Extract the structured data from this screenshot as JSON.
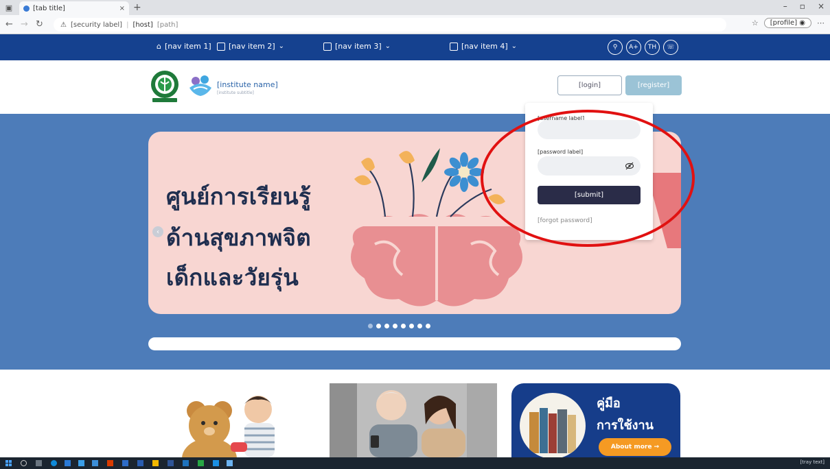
{
  "browser": {
    "tab_title": "[tab title]",
    "tab_close": "×",
    "new_tab": "+",
    "address": {
      "security_label": "[security label]",
      "host": "[host]",
      "path": "[path]"
    },
    "profile_label": "[profile]",
    "window_controls": [
      "–",
      "▫",
      "×"
    ]
  },
  "site_nav": {
    "items": [
      {
        "label": "[nav item 1]",
        "has_dropdown": false
      },
      {
        "label": "[nav item 2]",
        "has_dropdown": true
      },
      {
        "label": "[nav item 3]",
        "has_dropdown": true
      },
      {
        "label": "[nav item 4]",
        "has_dropdown": true
      }
    ],
    "chevron": "⌄",
    "circle_buttons": [
      "⚲",
      "A+",
      "TH",
      "☏"
    ]
  },
  "header": {
    "institute_name": "[institute name]",
    "institute_subtitle": "[institute subtitle]",
    "login_button": "[login]",
    "register_button": "[register]"
  },
  "hero": {
    "headline_lines": [
      "ศูนย์การเรียนรู้",
      "ด้านสุขภาพจิต",
      "เด็กและวัยรุ่น"
    ],
    "slide_count": 8,
    "active_slide": 0,
    "prev_arrow": "‹"
  },
  "login_popover": {
    "username_label": "[username label]",
    "password_label": "[password label]",
    "submit_label": "[submit]",
    "forgot_label": "[forgot password]"
  },
  "cards": {
    "manual_title": "คู่มือ",
    "manual_subtitle": "การใช้งาน",
    "about_button": "About more →"
  },
  "taskbar": {
    "tray_text": "[tray text]"
  },
  "colors": {
    "nav_blue": "#15418f",
    "hero_blue": "#4d7cb9",
    "banner_pink": "#f8d6d2",
    "annotation_red": "#e11111",
    "about_orange": "#f59a23"
  }
}
